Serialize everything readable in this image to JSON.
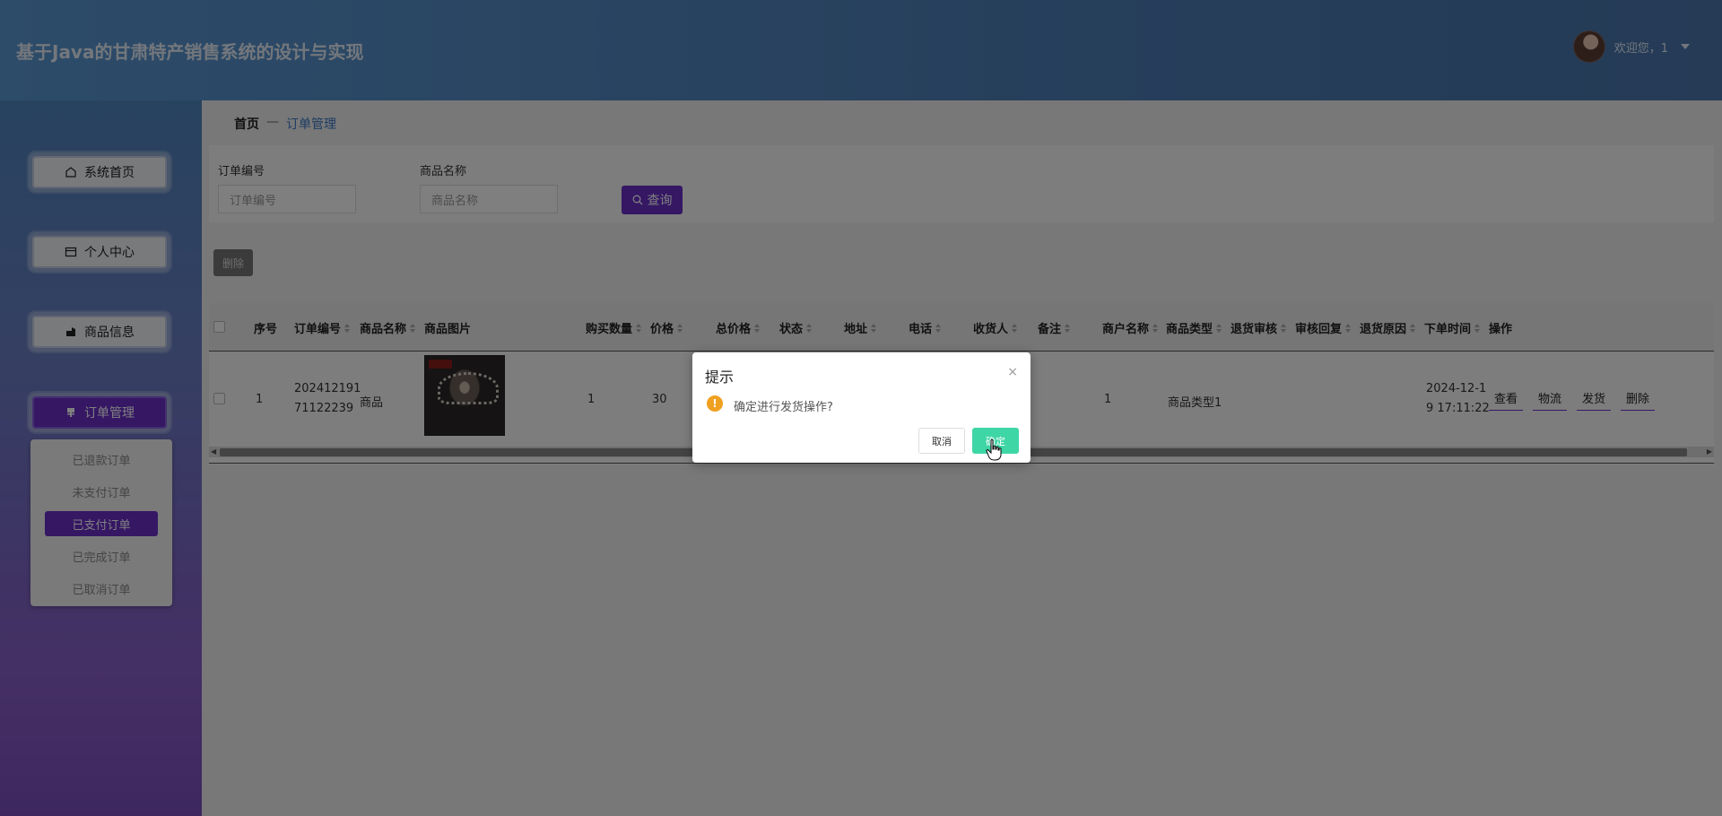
{
  "header": {
    "title": "基于Java的甘肃特产销售系统的设计与实现",
    "welcome": "欢迎您，1"
  },
  "sidebar": {
    "items": [
      {
        "label": "系统首页",
        "icon": "home-icon"
      },
      {
        "label": "个人中心",
        "icon": "card-icon"
      },
      {
        "label": "商品信息",
        "icon": "shop-icon"
      },
      {
        "label": "订单管理",
        "icon": "order-icon"
      }
    ],
    "submenu": [
      "已退款订单",
      "未支付订单",
      "已支付订单",
      "已完成订单",
      "已取消订单"
    ]
  },
  "breadcrumb": {
    "home": "首页",
    "sep": "—",
    "current": "订单管理"
  },
  "search": {
    "order_no_label": "订单编号",
    "order_no_placeholder": "订单编号",
    "goods_name_label": "商品名称",
    "goods_name_placeholder": "商品名称",
    "query_label": "查询"
  },
  "toolbar": {
    "delete_label": "删除"
  },
  "table": {
    "headers": [
      "序号",
      "订单编号",
      "商品名称",
      "商品图片",
      "购买数量",
      "价格",
      "总价格",
      "状态",
      "地址",
      "电话",
      "收货人",
      "备注",
      "商户名称",
      "商品类型",
      "退货审核",
      "审核回复",
      "退货原因",
      "下单时间",
      "操作"
    ],
    "row": {
      "index": "1",
      "order_no_1": "202412191",
      "order_no_2": "71122239",
      "goods_name": "商品",
      "quantity": "1",
      "price": "30",
      "merchant": "1",
      "goods_type": "商品类型1",
      "order_time_1": "2024-12-1",
      "order_time_2": "9 17:11:22"
    },
    "actions": [
      "查看",
      "物流",
      "发货",
      "删除"
    ]
  },
  "dialog": {
    "title": "提示",
    "close": "×",
    "message": "确定进行发货操作?",
    "cancel": "取消",
    "ok": "确定"
  },
  "colors": {
    "accent": "#6b2fc9",
    "confirm": "#3fd6a6",
    "warning": "#f0a020"
  }
}
